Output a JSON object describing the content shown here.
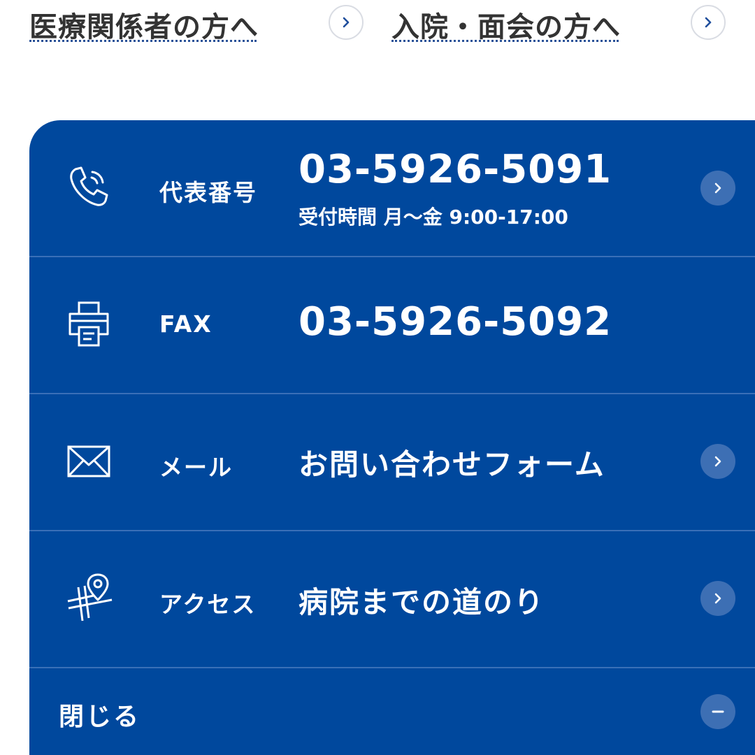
{
  "top_links": [
    {
      "label": "医療関係者の方へ"
    },
    {
      "label": "入院・面会の方へ"
    }
  ],
  "contacts": {
    "phone": {
      "label": "代表番号",
      "value": "03-5926-5091",
      "sub": "受付時間 月〜金 9:00-17:00",
      "icon": "phone-icon"
    },
    "fax": {
      "label": "FAX",
      "value": "03-5926-5092",
      "icon": "printer-icon"
    },
    "mail": {
      "label": "メール",
      "value": "お問い合わせフォーム",
      "icon": "envelope-icon"
    },
    "access": {
      "label": "アクセス",
      "value": "病院までの道のり",
      "icon": "map-pin-icon"
    }
  },
  "close": {
    "label": "閉じる",
    "icon": "minus-icon"
  },
  "colors": {
    "panel": "#00489d",
    "divider": "#3a6fb7",
    "button": "#3d6fb4",
    "link_underline": "#2a5298"
  }
}
